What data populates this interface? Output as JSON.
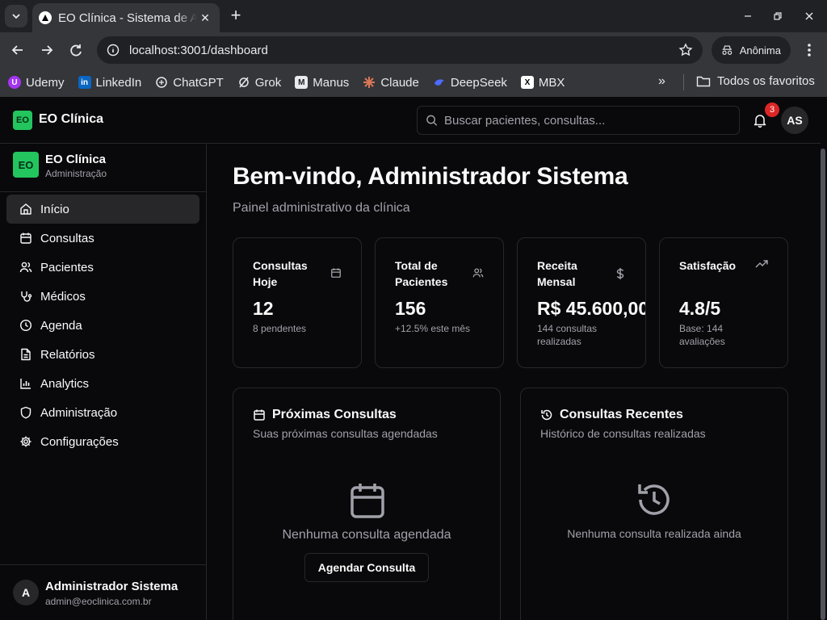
{
  "browser": {
    "tab_title": "EO Clínica - Sistema de Agendamento",
    "tab_close": "✕",
    "new_tab": "+",
    "url": "localhost:3001/dashboard",
    "incognito_label": "Anônima",
    "bookmarks": [
      "Udemy",
      "LinkedIn",
      "ChatGPT",
      "Grok",
      "Manus",
      "Claude",
      "DeepSeek",
      "MBX"
    ],
    "bookmarks_more": "»",
    "all_bookmarks": "Todos os favoritos"
  },
  "app": {
    "logo_text": "EO",
    "brand": "EO Clínica",
    "search_placeholder": "Buscar pacientes, consultas...",
    "notification_count": "3",
    "user_initials": "AS"
  },
  "sidebar": {
    "logo_text": "EO",
    "clinic_name": "EO Clínica",
    "role": "Administração",
    "items": [
      {
        "label": "Início",
        "icon": "home-icon",
        "active": true
      },
      {
        "label": "Consultas",
        "icon": "calendar-icon"
      },
      {
        "label": "Pacientes",
        "icon": "users-icon"
      },
      {
        "label": "Médicos",
        "icon": "stethoscope-icon"
      },
      {
        "label": "Agenda",
        "icon": "clock-icon"
      },
      {
        "label": "Relatórios",
        "icon": "file-text-icon"
      },
      {
        "label": "Analytics",
        "icon": "bar-chart-icon"
      },
      {
        "label": "Administração",
        "icon": "shield-icon"
      },
      {
        "label": "Configurações",
        "icon": "gear-icon"
      }
    ],
    "user": {
      "avatar": "A",
      "name": "Administrador Sistema",
      "email": "admin@eoclinica.com.br"
    }
  },
  "main": {
    "welcome": "Bem-vindo, Administrador Sistema",
    "subtitle": "Painel administrativo da clínica",
    "stats": [
      {
        "title": "Consultas Hoje",
        "value": "12",
        "note": "8 pendentes",
        "icon": "calendar-icon"
      },
      {
        "title": "Total de Pacientes",
        "value": "156",
        "note": "+12.5% este mês",
        "icon": "users-icon"
      },
      {
        "title": "Receita Mensal",
        "value": "R$ 45.600,00",
        "note": "144 consultas realizadas",
        "icon": "dollar-icon"
      },
      {
        "title": "Satisfação",
        "value": "4.8/5",
        "note": "Base: 144 avaliações",
        "icon": "trending-up-icon"
      }
    ],
    "upcoming": {
      "title": "Próximas Consultas",
      "description": "Suas próximas consultas agendadas",
      "empty_text": "Nenhuma consulta agendada",
      "button": "Agendar Consulta"
    },
    "recent": {
      "title": "Consultas Recentes",
      "description": "Histórico de consultas realizadas",
      "empty_text": "Nenhuma consulta realizada ainda"
    }
  }
}
